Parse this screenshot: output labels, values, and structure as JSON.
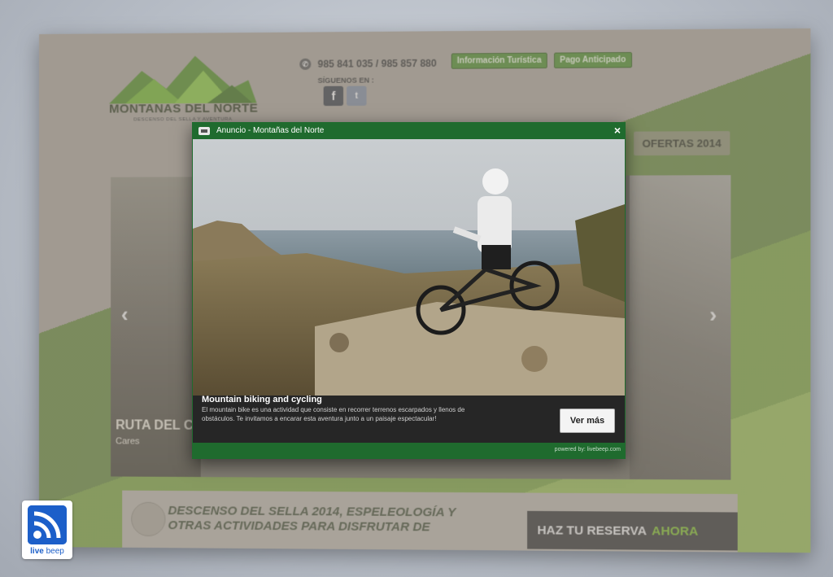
{
  "site": {
    "logo_title": "MONTANAS DEL NORTE",
    "logo_subtitle": "DESCENSO DEL SELLA Y AVENTURA",
    "phone": "985 841 035 / 985 857 880",
    "follow_label": "SÍGUENOS EN :",
    "social": [
      "facebook-icon",
      "twitter-icon"
    ],
    "top_buttons": [
      "Información Turística",
      "Pago Anticipado"
    ],
    "offers_button": "OFERTAS 2014",
    "slide_title": "RUTA DEL CA",
    "slide_subtitle": "Cares",
    "bottom_title": "DESCENSO DEL SELLA 2014, ESPELEOLOGÍA Y OTRAS ACTIVIDADES PARA DISFRUTAR DE",
    "reserve_label": "HAZ TU RESERVA",
    "reserve_accent": "AHORA"
  },
  "modal": {
    "title": "Anuncio - Montañas del Norte",
    "close_label": "×",
    "caption_title": "Mountain biking and cycling",
    "caption_text": "El mountain bike es una actividad que consiste en recorrer terrenos escarpados y llenos de obstáculos. Te invitamos a encarar esta aventura junto a un paisaje espectacular!",
    "cta_label": "Ver más",
    "powered_by": "powered by: livebeep.com"
  },
  "badge": {
    "brand_live": "live",
    "brand_beep": "beep"
  },
  "colors": {
    "modal_green": "#1f6b2e",
    "site_green": "#6aa223",
    "badge_blue": "#1c5fc9"
  }
}
